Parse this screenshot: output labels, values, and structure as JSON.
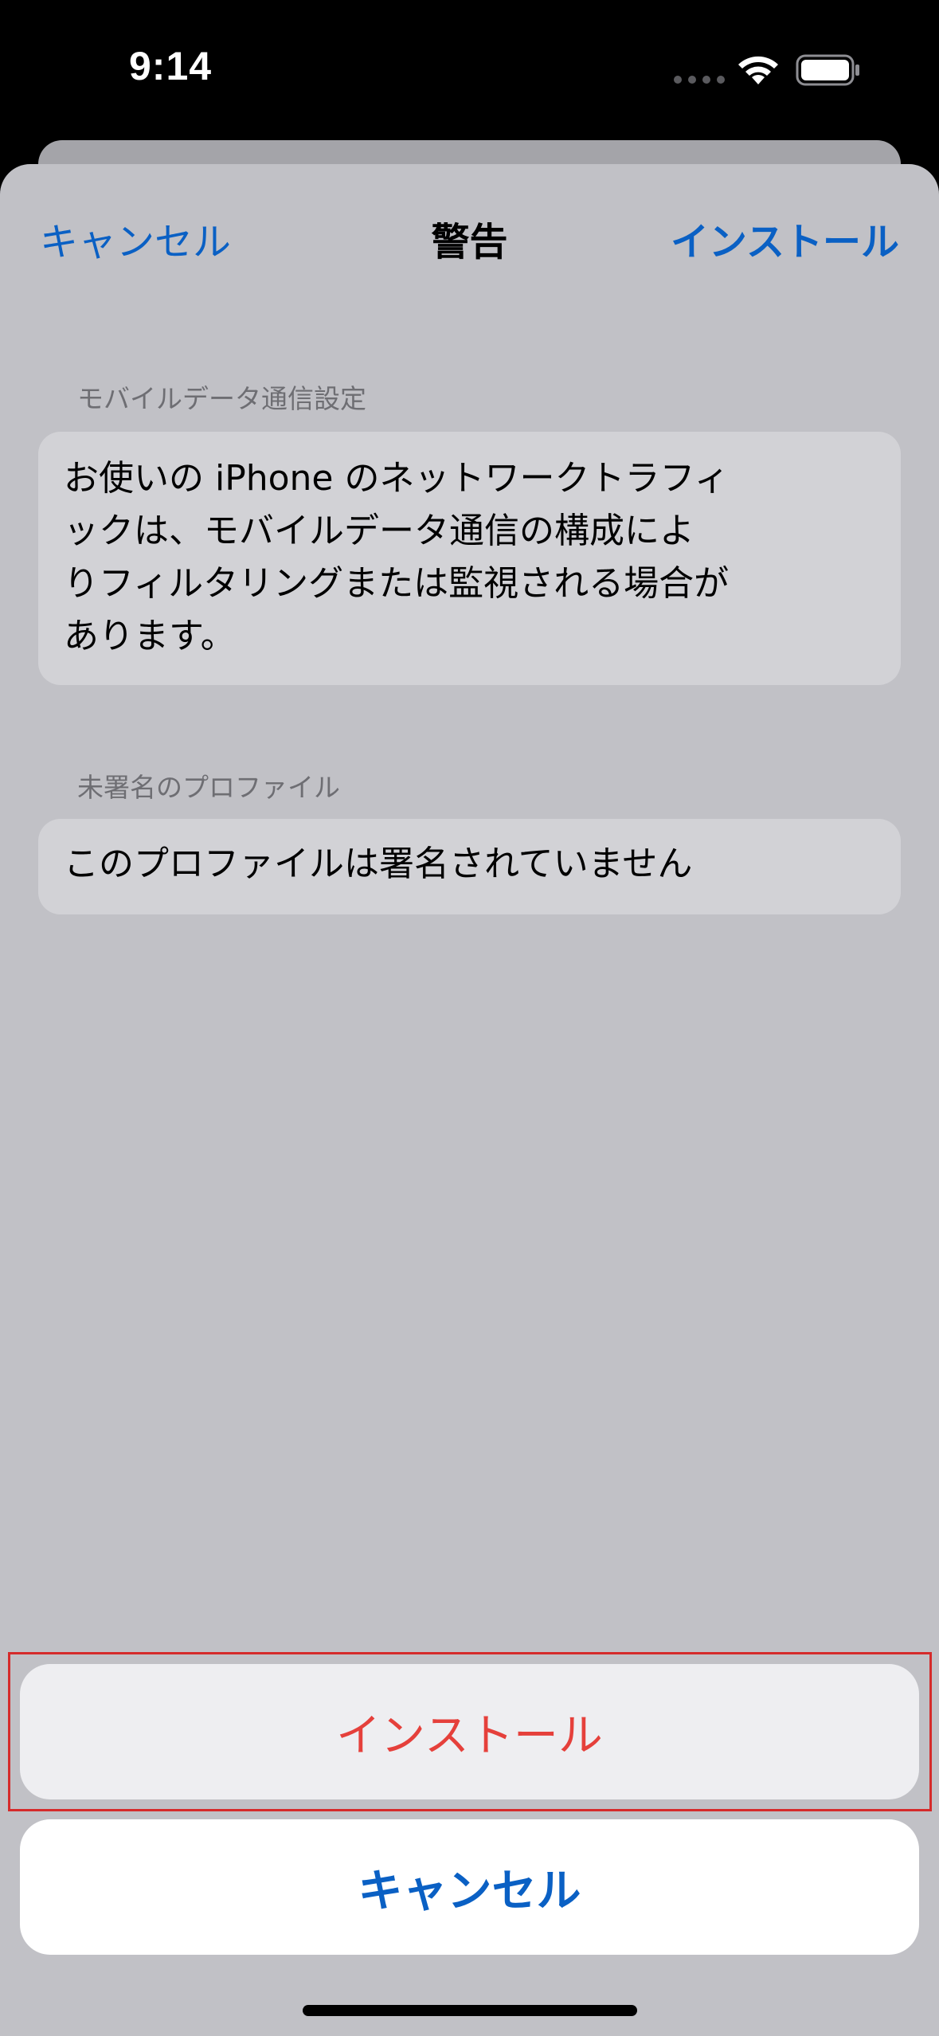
{
  "status_bar": {
    "time": "9:14",
    "icons": [
      "cellular-dots-icon",
      "wifi-icon",
      "battery-icon"
    ]
  },
  "nav": {
    "cancel_label": "キャンセル",
    "title": "警告",
    "install_label": "インストール"
  },
  "sections": [
    {
      "header": "モバイルデータ通信設定",
      "lines": [
        "お使いの iPhone のネットワークトラフィ",
        "ックは、モバイルデータ通信の構成によ",
        "りフィルタリングまたは監視される場合が",
        "あります。"
      ]
    },
    {
      "header": "未署名のプロファイル",
      "body": "このプロファイルは署名されていません"
    }
  ],
  "action_sheet": {
    "install_label": "インストール",
    "cancel_label": "キャンセル"
  },
  "colors": {
    "accent_blue": "#0a60c4",
    "destructive_red": "#e5403b",
    "dim_background": "#c1c1c6"
  }
}
